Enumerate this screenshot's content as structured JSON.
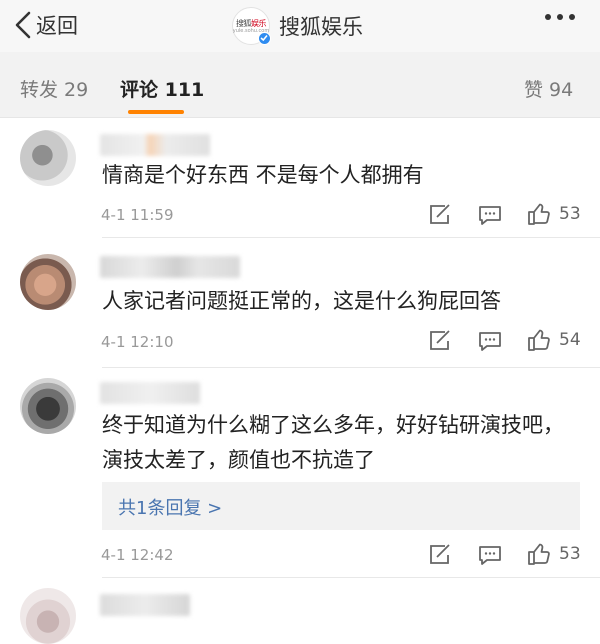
{
  "header": {
    "back_label": "返回",
    "account_name": "搜狐娱乐",
    "logo_text_a": "搜狐",
    "logo_text_b": "娱乐",
    "logo_sub": "yule.sohu.com"
  },
  "tabs": {
    "repost": "转发 29",
    "comment": "评论 111",
    "like": "赞 94"
  },
  "colors": {
    "accent": "#ff8200",
    "link": "#4a75b0",
    "verified": "#2f8cf0"
  },
  "icons": {
    "back": "chevron-left-icon",
    "more": "more-dots-icon",
    "repost": "repost-icon",
    "reply": "comment-icon",
    "like": "thumb-up-icon"
  },
  "comments": [
    {
      "text": "情商是个好东西 不是每个人都拥有",
      "time": "4-1 11:59",
      "likes": "53"
    },
    {
      "text": "人家记者问题挺正常的，这是什么狗屁回答",
      "time": "4-1 12:10",
      "likes": "54"
    },
    {
      "text": "终于知道为什么糊了这么多年，好好钻研演技吧，演技太差了，颜值也不抗造了",
      "time": "4-1 12:42",
      "likes": "53",
      "reply_link": "共1条回复 >"
    }
  ]
}
